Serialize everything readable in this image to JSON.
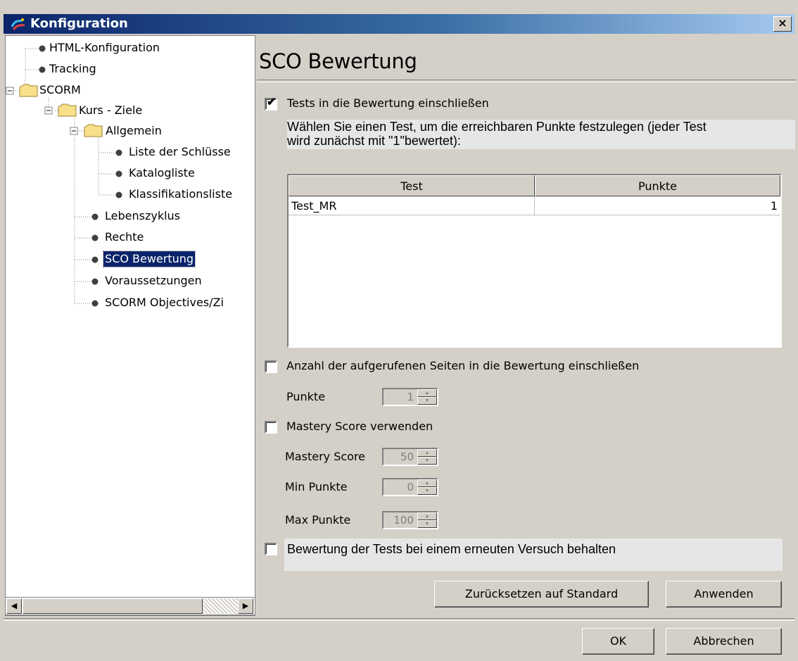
{
  "window": {
    "title": "Konfiguration",
    "close_label": "×"
  },
  "tree": [
    {
      "label": "HTML-Konfiguration"
    },
    {
      "label": "Tracking"
    },
    {
      "label": "SCORM"
    },
    {
      "label": "Kurs - Ziele"
    },
    {
      "label": "Allgemein"
    },
    {
      "label": "Liste der Schlüsse"
    },
    {
      "label": "Katalogliste"
    },
    {
      "label": "Klassifikationsliste"
    },
    {
      "label": "Lebenszyklus"
    },
    {
      "label": "Rechte"
    },
    {
      "label": "SCO Bewertung",
      "selected": true
    },
    {
      "label": "Voraussetzungen"
    },
    {
      "label": "SCORM Objectives/Zi"
    }
  ],
  "panel": {
    "title": "SCO Bewertung",
    "include_tests": {
      "label": "Tests in die Bewertung einschließen",
      "checked": true
    },
    "description_line1": "Wählen Sie einen Test, um die erreichbaren Punkte festzulegen (jeder Test",
    "description_line2": "wird zunächst mit \"1\"bewertet):",
    "table": {
      "columns": [
        "Test",
        "Punkte"
      ],
      "rows": [
        {
          "test": "Test_MR",
          "punkte": "1"
        }
      ]
    },
    "include_pages": {
      "label": "Anzahl der aufgerufenen Seiten in die Bewertung einschließen",
      "checked": false
    },
    "pages_points": {
      "label": "Punkte",
      "value": "1"
    },
    "mastery": {
      "label": "Mastery Score verwenden",
      "checked": false
    },
    "mastery_score": {
      "label": "Mastery Score",
      "value": "50"
    },
    "min_points": {
      "label": "Min Punkte",
      "value": "0"
    },
    "max_points": {
      "label": "Max Punkte",
      "value": "100"
    },
    "retain": {
      "label": "Bewertung der Tests bei einem erneuten Versuch behalten",
      "checked": false
    },
    "reset_button": "Zurücksetzen auf Standard",
    "apply_button": "Anwenden"
  },
  "footer": {
    "ok_button": "OK",
    "cancel_button": "Abbrechen"
  }
}
